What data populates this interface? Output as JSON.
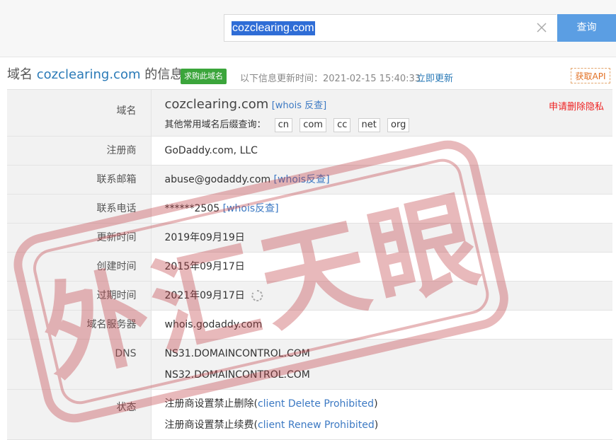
{
  "search": {
    "value": "cozclearing.com",
    "button": "查询"
  },
  "header": {
    "title_prefix": "域名 ",
    "title_domain": "cozclearing.com",
    "title_suffix": " 的信息",
    "buy_badge": "求购此域名",
    "update_text": "以下信息更新时间：2021-02-15 15:40:33",
    "update_link": "立即更新",
    "api_button": "获取API"
  },
  "rows": {
    "domain": {
      "label": "域名",
      "value": "cozclearing.com",
      "whois_link": "[whois 反查]",
      "suffix_prompt": "其他常用域名后缀查询：",
      "suffixes": [
        "cn",
        "com",
        "cc",
        "net",
        "org"
      ],
      "privacy_link": "申请删除隐私"
    },
    "registrar": {
      "label": "注册商",
      "value": "GoDaddy.com, LLC"
    },
    "email": {
      "label": "联系邮箱",
      "value": "abuse@godaddy.com",
      "link": "[whois反查]"
    },
    "phone": {
      "label": "联系电话",
      "value": "******2505",
      "link": "[whois反查]"
    },
    "updated": {
      "label": "更新时间",
      "value": "2019年09月19日"
    },
    "created": {
      "label": "创建时间",
      "value": "2015年09月17日"
    },
    "expires": {
      "label": "过期时间",
      "value": "2021年09月17日"
    },
    "nameserver": {
      "label": "域名服务器",
      "value": "whois.godaddy.com"
    },
    "dns": {
      "label": "DNS",
      "values": [
        "NS31.DOMAINCONTROL.COM",
        "NS32.DOMAINCONTROL.COM"
      ]
    },
    "status": {
      "label": "状态",
      "items": [
        {
          "text": "注册商设置禁止删除(",
          "code": "client Delete Prohibited",
          "close": ")"
        },
        {
          "text": "注册商设置禁止续费(",
          "code": "client Renew Prohibited",
          "close": ")"
        }
      ]
    }
  },
  "watermark": {
    "text": "外汇天眼"
  },
  "colors": {
    "accent": "#5b9ee3",
    "link": "#3c79c3",
    "buy": "#3ba53b",
    "warn": "#e22",
    "stamp": "#c0393f"
  }
}
